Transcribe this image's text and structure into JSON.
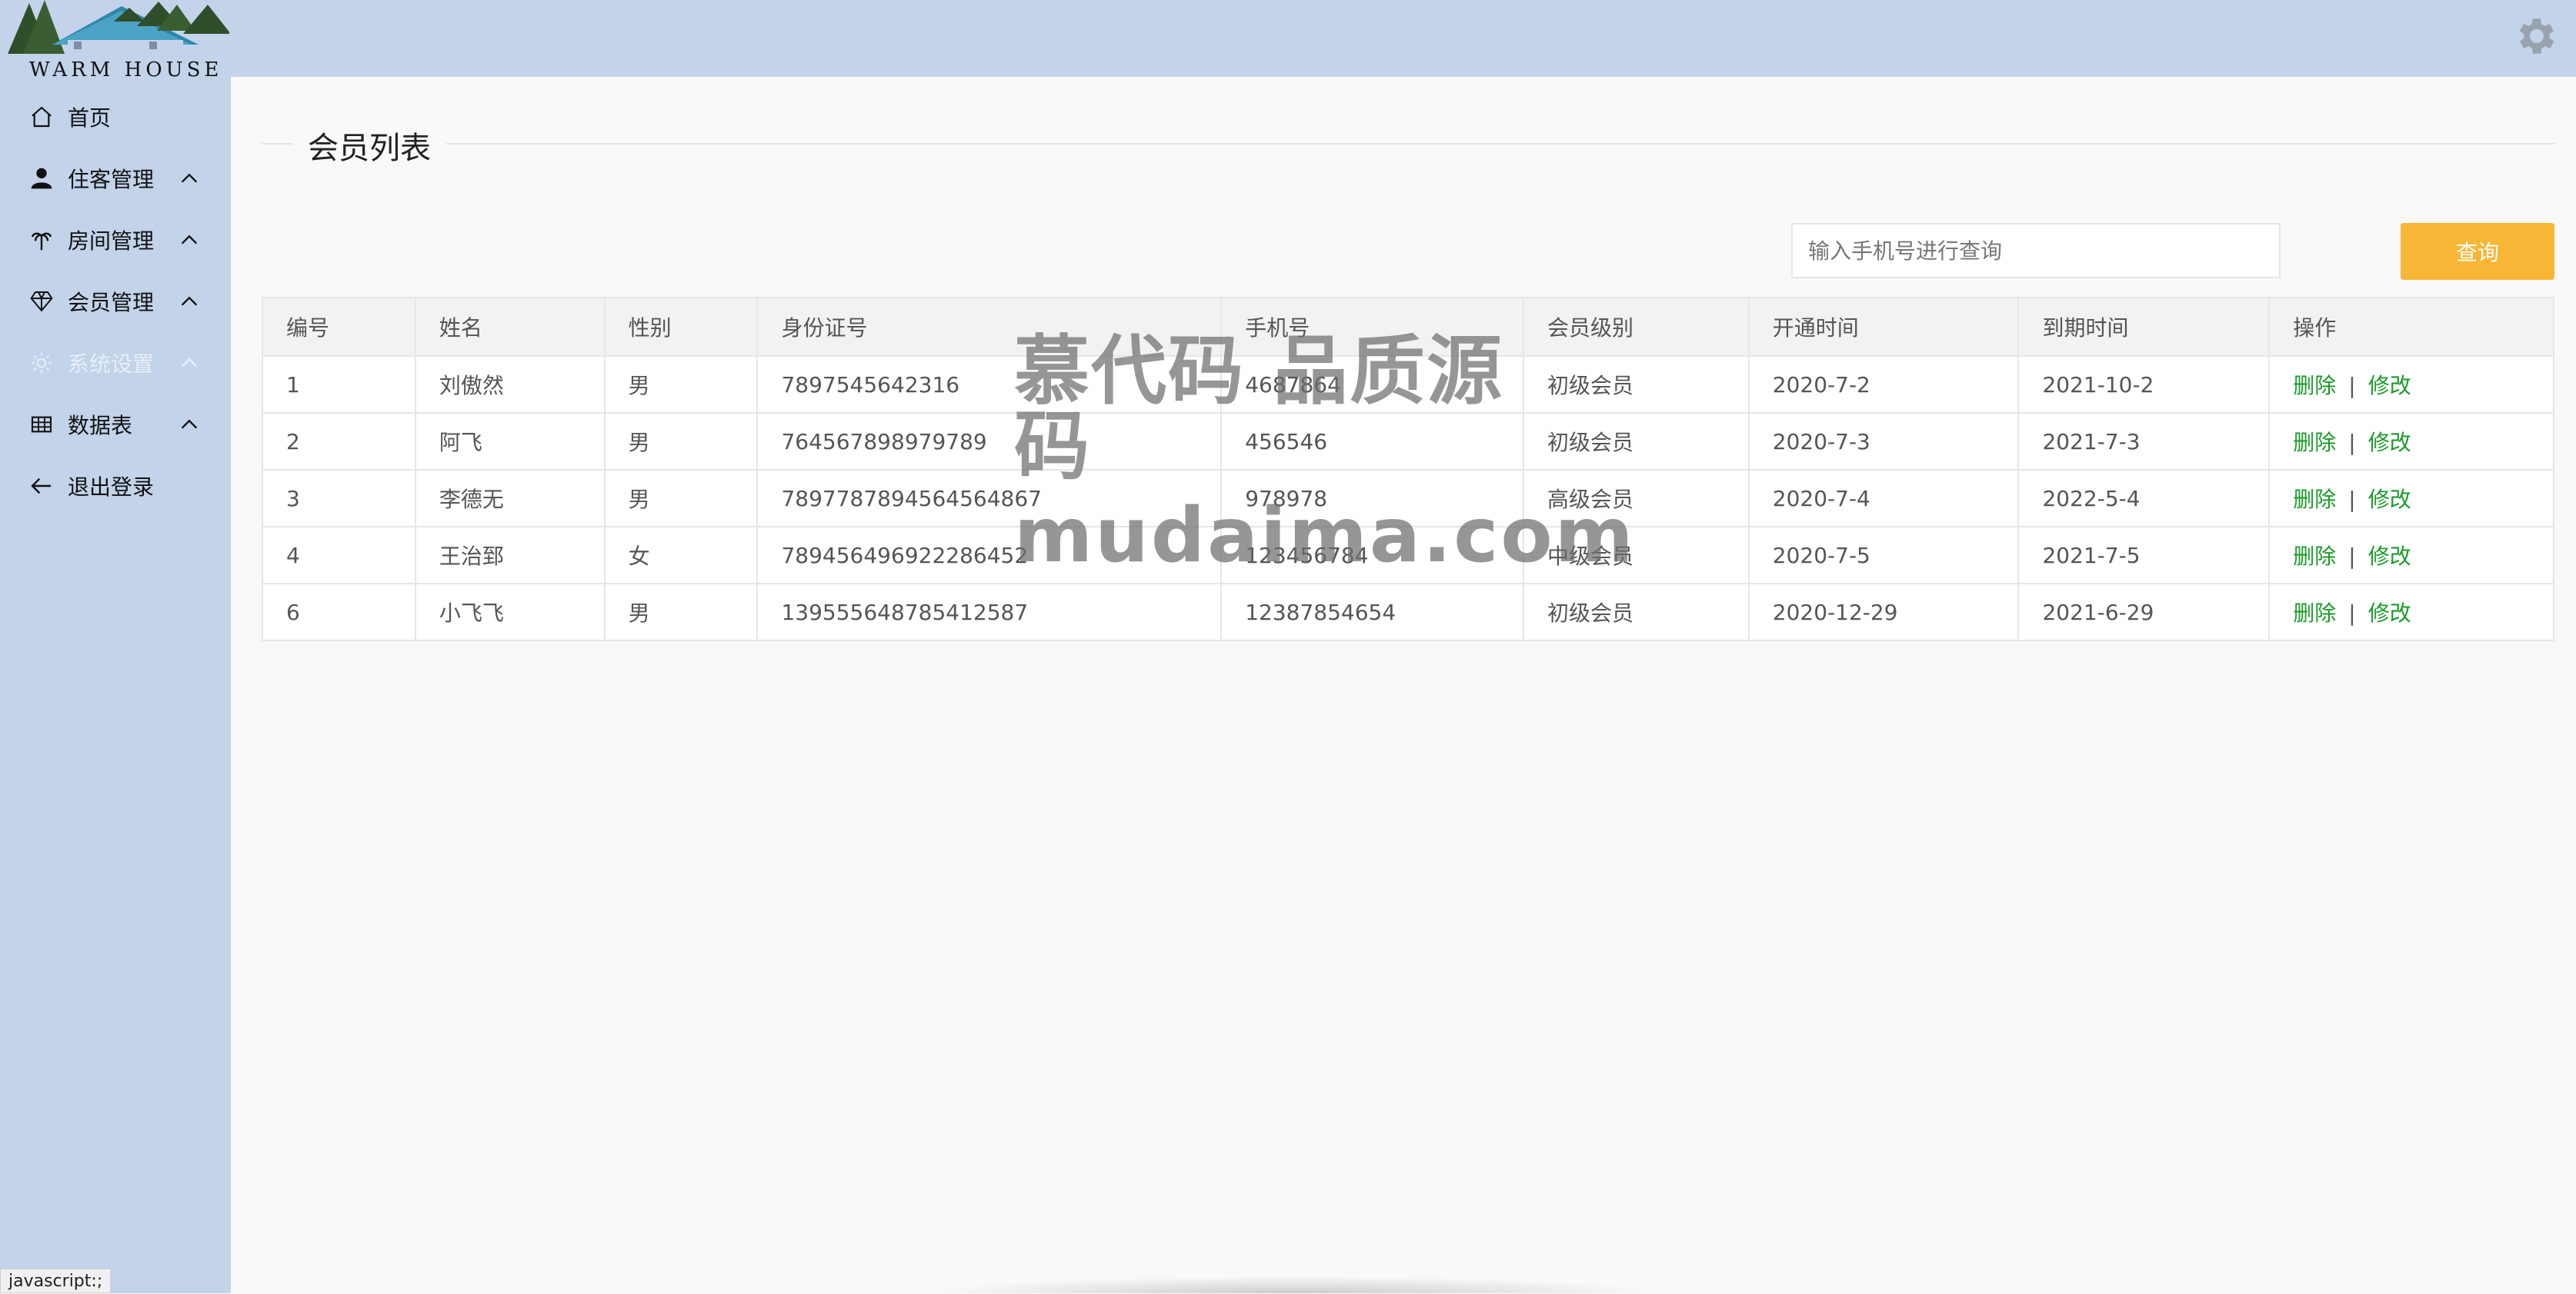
{
  "logo": {
    "text": "WARM HOUSE"
  },
  "sidebar": {
    "items": [
      {
        "label": "首页",
        "icon": "home-icon"
      },
      {
        "label": "住客管理",
        "icon": "user-icon"
      },
      {
        "label": "房间管理",
        "icon": "palm-tree-icon"
      },
      {
        "label": "会员管理",
        "icon": "diamond-icon"
      },
      {
        "label": "系统设置",
        "icon": "gear-icon"
      },
      {
        "label": "数据表",
        "icon": "table-icon"
      },
      {
        "label": "退出登录",
        "icon": "arrow-left-icon"
      }
    ]
  },
  "page": {
    "title": "会员列表"
  },
  "search": {
    "placeholder": "输入手机号进行查询",
    "button_label": "查询"
  },
  "table": {
    "headers": [
      "编号",
      "姓名",
      "性别",
      "身份证号",
      "手机号",
      "会员级别",
      "开通时间",
      "到期时间",
      "操作"
    ],
    "delete_label": "删除",
    "separator": "|",
    "edit_label": "修改",
    "rows": [
      {
        "id": "1",
        "name": "刘傲然",
        "gender": "男",
        "id_card": "7897545642316",
        "phone": "4687864",
        "level": "初级会员",
        "level_color": "#1e3f99",
        "start": "2020-7-2",
        "end": "2021-10-2"
      },
      {
        "id": "2",
        "name": "阿飞",
        "gender": "男",
        "id_card": "764567898979789",
        "phone": "456546",
        "level": "初级会员",
        "level_color": "#1e3f99",
        "start": "2020-7-3",
        "end": "2021-7-3"
      },
      {
        "id": "3",
        "name": "李德无",
        "gender": "男",
        "id_card": "7897787894564564867",
        "phone": "978978",
        "level": "高级会员",
        "level_color": "#d5302a",
        "start": "2020-7-4",
        "end": "2022-5-4"
      },
      {
        "id": "4",
        "name": "王治郅",
        "gender": "女",
        "id_card": "789456496922286452",
        "phone": "123456784",
        "level": "中级会员",
        "level_color": "#f1b13b",
        "start": "2020-7-5",
        "end": "2021-7-5"
      },
      {
        "id": "6",
        "name": "小飞飞",
        "gender": "男",
        "id_card": "139555648785412587",
        "phone": "12387854654",
        "level": "初级会员",
        "level_color": "#1e3f99",
        "start": "2020-12-29",
        "end": "2021-6-29"
      }
    ]
  },
  "watermark": {
    "line1": "慕代码 品质源码",
    "line2": "mudaima.com"
  },
  "statusbar": {
    "link": "javascript:;"
  },
  "colors": {
    "sidebar_bg": "#c2d3ea",
    "accent_button": "#f8b637",
    "action_green": "#1b9b2a"
  }
}
